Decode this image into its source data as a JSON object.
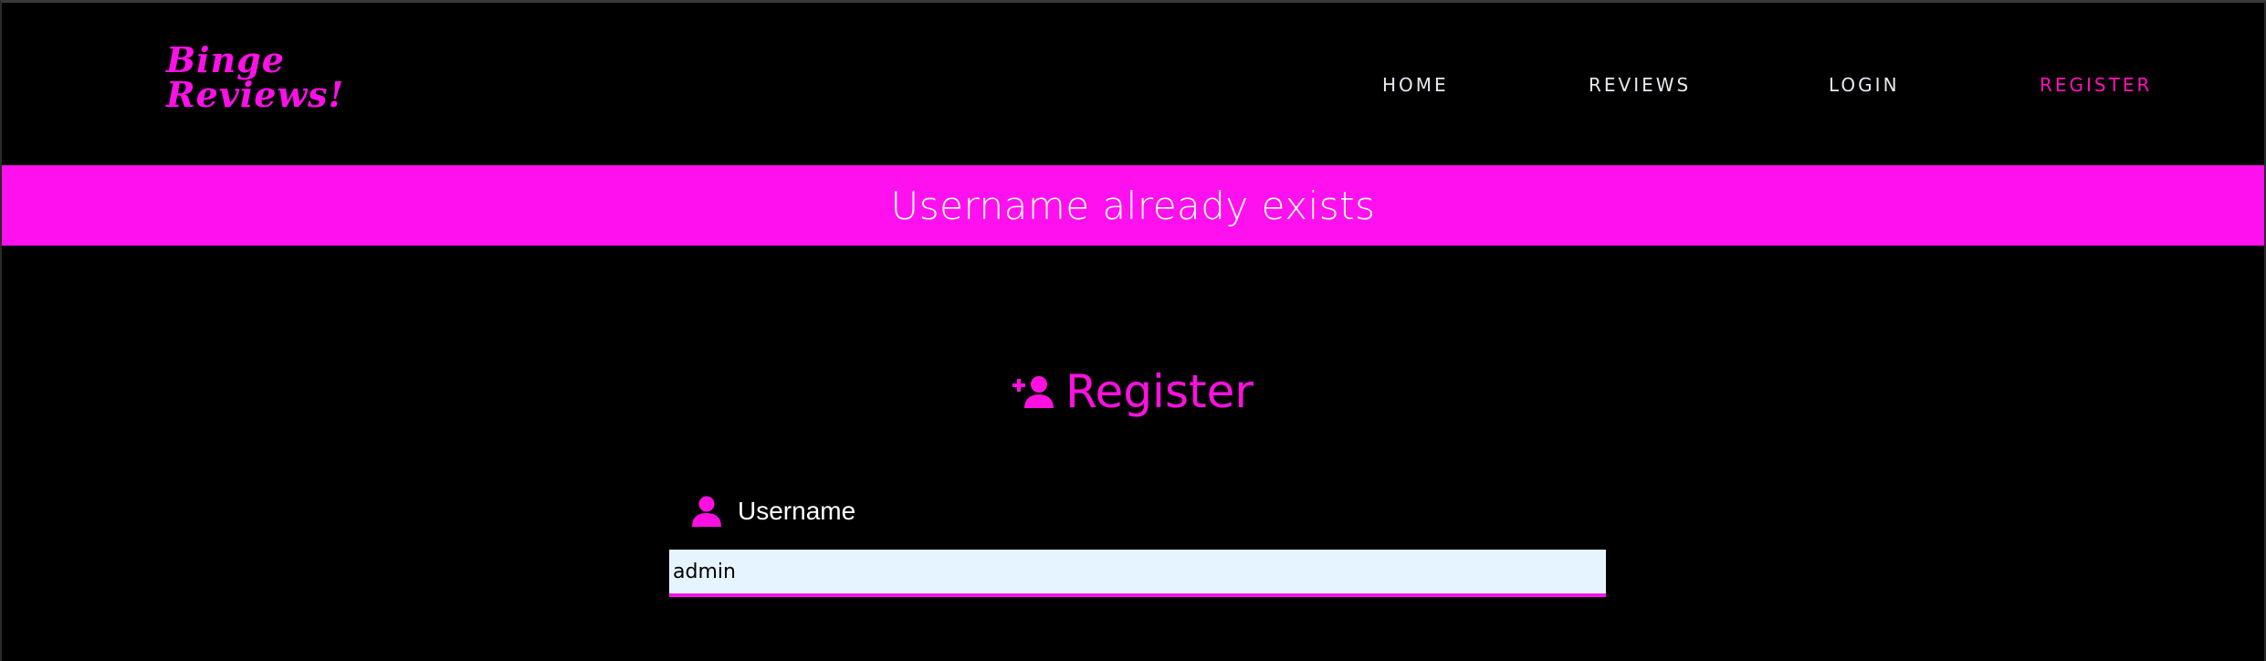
{
  "brand": {
    "line1": "Binge",
    "line2": "Reviews!"
  },
  "nav": {
    "home": "HOME",
    "reviews": "REVIEWS",
    "login": "LOGIN",
    "register": "REGISTER"
  },
  "flash": {
    "message": "Username already exists"
  },
  "register": {
    "heading": "Register",
    "heading_icon": "user-plus-icon"
  },
  "form": {
    "username_label": "Username",
    "username_icon": "user-icon",
    "username_value": "admin"
  },
  "colors": {
    "accent": "#ff10e8",
    "active_nav": "#ff10b8",
    "input_bg": "#e6f4ff",
    "background": "#000000"
  }
}
